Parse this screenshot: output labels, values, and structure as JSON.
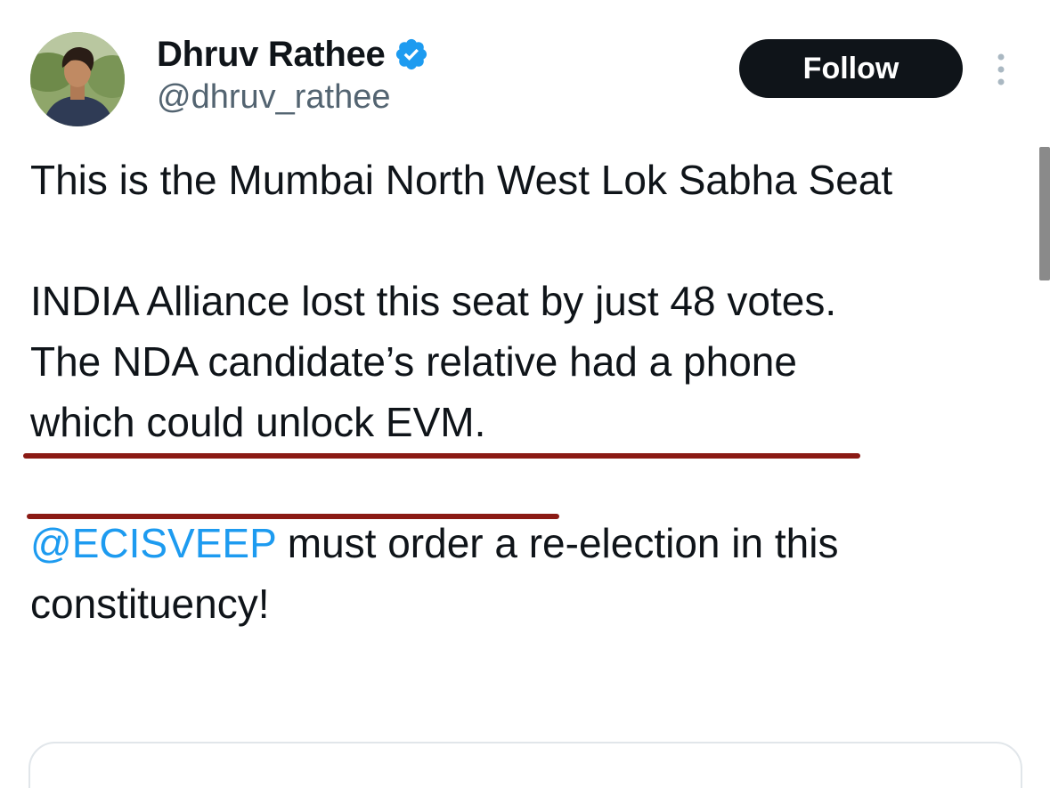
{
  "author": {
    "display_name": "Dhruv Rathee",
    "handle": "@dhruv_rathee",
    "verified": true,
    "verified_color": "#1d9bf0"
  },
  "actions": {
    "follow_label": "Follow"
  },
  "icons": {
    "verified": "verified-badge-icon",
    "more": "more-vertical-icon"
  },
  "tweet": {
    "para1": "This is the Mumbai North West Lok Sabha Seat",
    "para2_line1": "INDIA Alliance lost this seat by just 48 votes.",
    "para2_line2": "The NDA candidate’s relative had a phone",
    "para2_line3": "which could unlock EVM.",
    "para3_mention": "@ECISVEEP",
    "para3_rest": " must order a re-election in this constituency!"
  },
  "colors": {
    "text": "#0f1419",
    "secondary": "#536471",
    "link": "#1d9bf0",
    "underline_annotation": "#8b1a14",
    "button_bg": "#0f1419"
  }
}
